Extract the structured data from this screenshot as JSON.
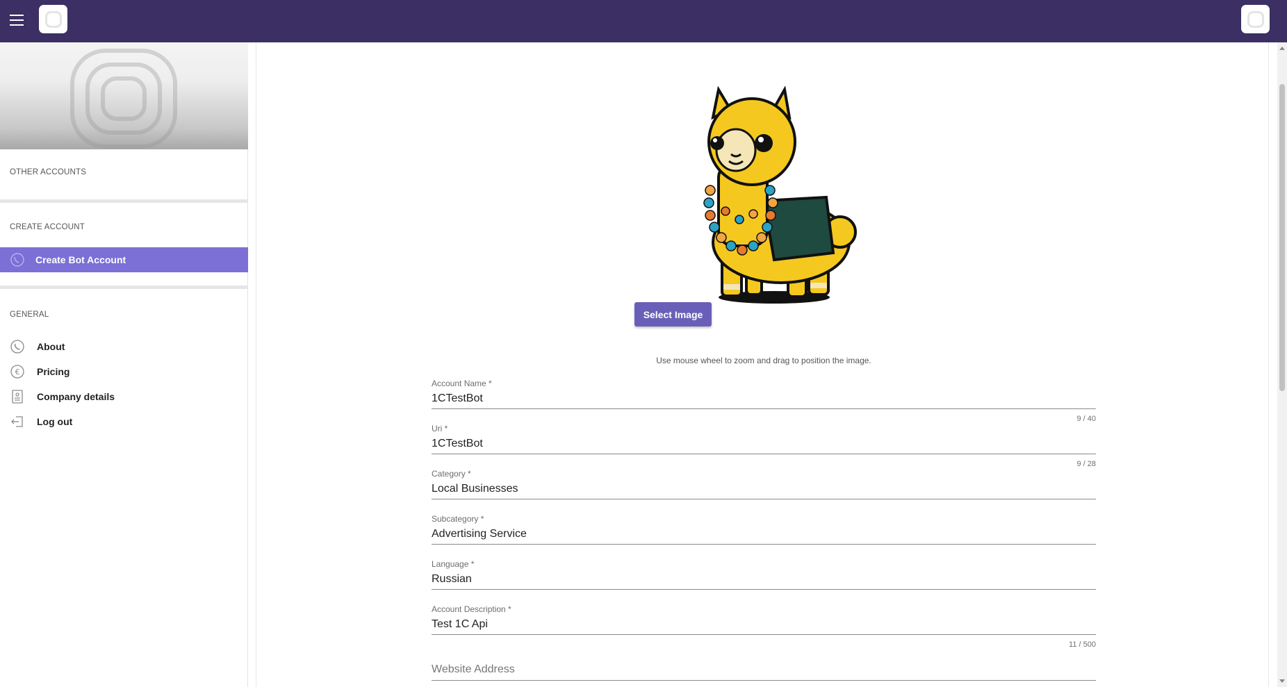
{
  "sidebar": {
    "other_accounts_label": "OTHER ACCOUNTS",
    "create_account_label": "CREATE ACCOUNT",
    "create_bot_label": "Create Bot Account",
    "general_label": "GENERAL",
    "items": [
      {
        "label": "About",
        "icon": "phone-icon"
      },
      {
        "label": "Pricing",
        "icon": "euro-icon"
      },
      {
        "label": "Company details",
        "icon": "company-icon"
      },
      {
        "label": "Log out",
        "icon": "logout-icon"
      }
    ]
  },
  "main": {
    "select_image_label": "Select Image",
    "hint": "Use mouse wheel to zoom and drag to position the image.",
    "fields": [
      {
        "label": "Account Name *",
        "value": "1CTestBot",
        "counter": "9 / 40"
      },
      {
        "label": "Uri *",
        "value": "1CTestBot",
        "counter": "9 / 28"
      },
      {
        "label": "Category *",
        "value": "Local Businesses"
      },
      {
        "label": "Subcategory *",
        "value": "Advertising Service"
      },
      {
        "label": "Language *",
        "value": "Russian"
      },
      {
        "label": "Account Description *",
        "value": "Test 1C Api",
        "counter": "11 / 500"
      },
      {
        "placeholder": "Website Address"
      }
    ]
  },
  "colors": {
    "topbar": "#3b2f63",
    "accent": "#7c6fd6",
    "button": "#6a5fb8"
  }
}
